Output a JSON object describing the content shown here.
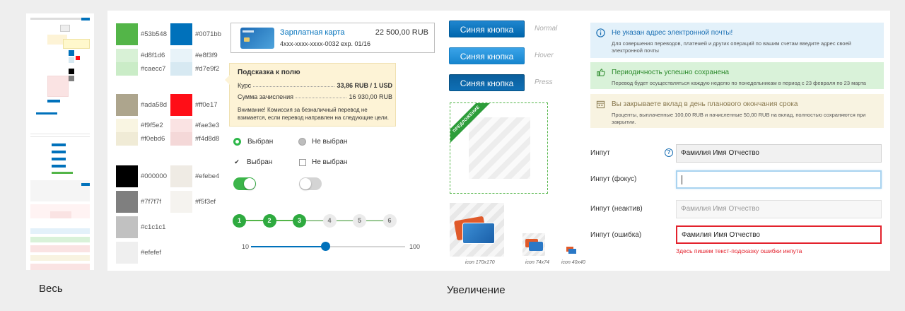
{
  "captions": {
    "full": "Весь",
    "zoom": "Увеличение"
  },
  "colors": [
    {
      "hex": "#53b548",
      "label": "#53b548"
    },
    {
      "hex": "#0071bb",
      "label": "#0071bb"
    },
    {
      "hex": "#d8f1d6",
      "label": "#d8f1d6"
    },
    {
      "hex": "#e8f3f9",
      "label": "#e8f3f9"
    },
    {
      "hex": "#caecc7",
      "label": "#caecc7"
    },
    {
      "hex": "#d7e9f2",
      "label": "#d7e9f2"
    },
    {
      "hex": "#ada58d",
      "label": "#ada58d"
    },
    {
      "hex": "#ff0e17",
      "label": "#ff0e17"
    },
    {
      "hex": "#f9f5e2",
      "label": "#f9f5e2"
    },
    {
      "hex": "#fae3e3",
      "label": "#fae3e3"
    },
    {
      "hex": "#f0ebd6",
      "label": "#f0ebd6"
    },
    {
      "hex": "#f4d8d8",
      "label": "#f4d8d8"
    },
    {
      "hex": "#000000",
      "label": "#000000"
    },
    {
      "hex": "#efebe4",
      "label": "#efebe4"
    },
    {
      "hex": "#7f7f7f",
      "label": "#7f7f7f"
    },
    {
      "hex": "#f5f3ef",
      "label": "#f5f3ef"
    },
    {
      "hex": "#c1c1c1",
      "label": "#c1c1c1"
    },
    {
      "hex": "#efefef",
      "label": "#efefef"
    }
  ],
  "card": {
    "name": "Зарплатная карта",
    "amount": "22 500,00 RUB",
    "number": "4xxx-xxxx-xxxx-0032 exp. 01/16"
  },
  "tooltip": {
    "title": "Подсказка к полю",
    "rate_label": "Курс",
    "rate_value": "33,86 RUB / 1 USD",
    "credit_label": "Сумма зачисления",
    "credit_value": "16 930,00 RUB",
    "note": "Внимание! Комиссия за безналичный перевод не взимается, если перевод направлен на следующие цели."
  },
  "controls": {
    "selected": "Выбран",
    "not_selected": "Не выбран"
  },
  "steps": [
    "1",
    "2",
    "3",
    "4",
    "5",
    "6"
  ],
  "slider": {
    "min": "10",
    "max": "100",
    "value_fraction": 0.48
  },
  "buttons": {
    "label": "Синяя кнопка",
    "states": [
      "Normal",
      "Hover",
      "Press"
    ]
  },
  "promo": {
    "ribbon": "ПРЕДЛОЖЕНИЕ"
  },
  "icons": [
    {
      "label": "icon 170x170"
    },
    {
      "label": "icon 74x74"
    },
    {
      "label": "icon 40x40"
    }
  ],
  "alerts": [
    {
      "title": "Не указан адрес электронной почты!",
      "desc": "Для совершения переводов, платежей и других операций по вашим счетам введите адрес своей электронной почты",
      "bg": "#e3f1fa",
      "fg": "#1a6fb3"
    },
    {
      "title": "Периодичность успешно сохранена",
      "desc": "Перевод будет осуществляться каждую неделю по понедельникам в период с 23 февраля по 23 марта",
      "bg": "#d9f2d9",
      "fg": "#2c8a2c"
    },
    {
      "title": "Вы закрываете вклад в день планового окончания срока",
      "desc": "Проценты, выплаченные 100,00 RUB и начисленные 50,00 RUB на вклад, полностью сохраняются при закрытии.",
      "bg": "#f8f3e1",
      "fg": "#8a7a50"
    }
  ],
  "inputs": [
    {
      "label": "Инпут",
      "value": "Фамилия Имя Отчество"
    },
    {
      "label": "Инпут (фокус)",
      "value": ""
    },
    {
      "label": "Инпут (неактив)",
      "value": "Фамилия Имя Отчество"
    },
    {
      "label": "Инпут (ошибка)",
      "value": "Фамилия Имя Отчество"
    }
  ],
  "error_hint": "Здесь пишем текст-подсказку ошибки инпута",
  "help_icon": "?"
}
